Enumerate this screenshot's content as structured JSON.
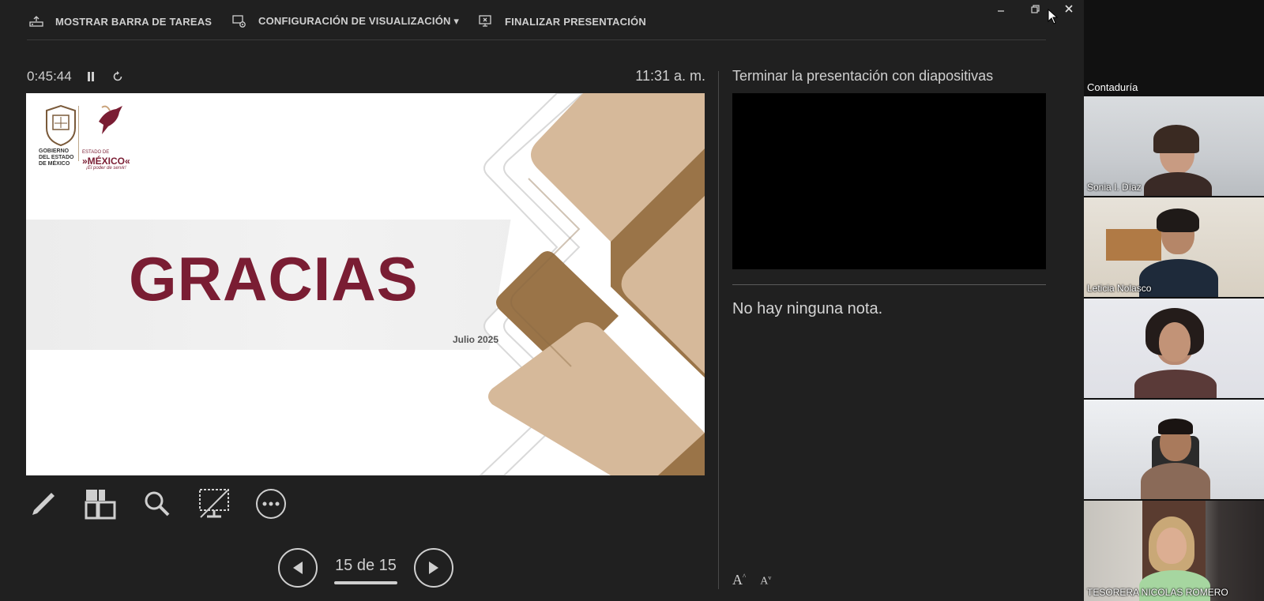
{
  "toolbar": {
    "show_taskbar": "MOSTRAR BARRA DE TAREAS",
    "display_settings": "CONFIGURACIÓN DE VISUALIZACIÓN ▾",
    "end_show": "FINALIZAR PRESENTACIÓN"
  },
  "timer": {
    "elapsed": "0:45:44",
    "clock": "11:31 a. m."
  },
  "slide": {
    "title": "GRACIAS",
    "date": "Julio 2025",
    "logo": {
      "gobierno": "GOBIERNO DEL ESTADO DE MÉXICO",
      "estado_de": "ESTADO DE",
      "mexico": "»MÉXICO«",
      "lema": "¡El poder de servir!"
    },
    "colors": {
      "brand": "#7a1d33",
      "tan_dark": "#9a7448",
      "tan_light": "#d6b99a"
    }
  },
  "navigation": {
    "page": "15 de 15"
  },
  "next_slide": {
    "title": "Terminar la presentación con diapositivas"
  },
  "notes": {
    "text": "No hay ninguna nota."
  },
  "font_controls": {
    "increase": "A",
    "decrease": "A"
  },
  "gallery": {
    "title": "Contaduría",
    "participants": [
      {
        "name": "Sonia I. Díaz"
      },
      {
        "name": "Leticia Nolasco"
      },
      {
        "name": ""
      },
      {
        "name": ""
      },
      {
        "name": "TESORERA NICOLAS ROMERO"
      }
    ]
  }
}
